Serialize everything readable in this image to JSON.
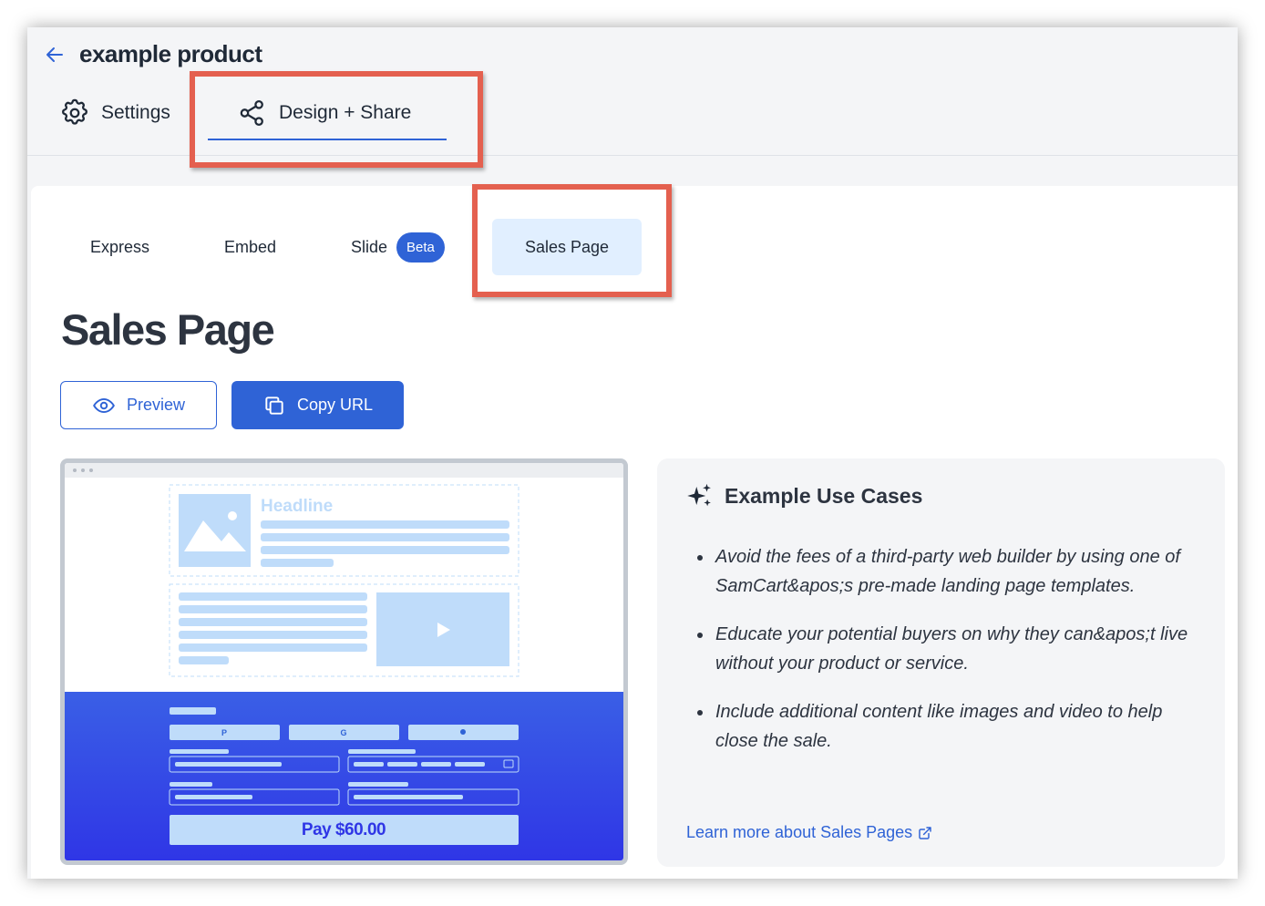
{
  "header": {
    "title": "example product",
    "back_icon": "arrow-left-icon"
  },
  "top_tabs": [
    {
      "label": "Settings",
      "icon": "gear-icon"
    },
    {
      "label": "Design + Share",
      "icon": "share-icon",
      "active": true
    }
  ],
  "sub_tabs": [
    {
      "label": "Express"
    },
    {
      "label": "Embed"
    },
    {
      "label": "Slide",
      "badge": "Beta"
    },
    {
      "label": "Sales Page",
      "active": true
    }
  ],
  "main": {
    "heading": "Sales Page",
    "preview_button": "Preview",
    "copy_button": "Copy URL"
  },
  "mockup": {
    "headline": "Headline",
    "pay_button": "Pay $60.00",
    "payment_icons": [
      "paypal-icon",
      "google-pay-icon",
      "apple-pay-icon"
    ]
  },
  "use_cases": {
    "title": "Example Use Cases",
    "items": [
      "Avoid the fees of a third-party web builder by using one of SamCart&apos;s pre-made landing page templates.",
      "Educate your potential buyers on why they can&apos;t live without your product or service.",
      "Include additional content like images and video to help close the sale."
    ],
    "learn_more": "Learn more about Sales Pages"
  },
  "colors": {
    "accent": "#2f63d6",
    "callout": "#e4604f",
    "sales_tab_bg": "#e1efff",
    "mock_light_blue": "#bfdcfa",
    "mock_gradient_start": "#3a5fe6",
    "mock_gradient_end": "#2f36e6"
  }
}
